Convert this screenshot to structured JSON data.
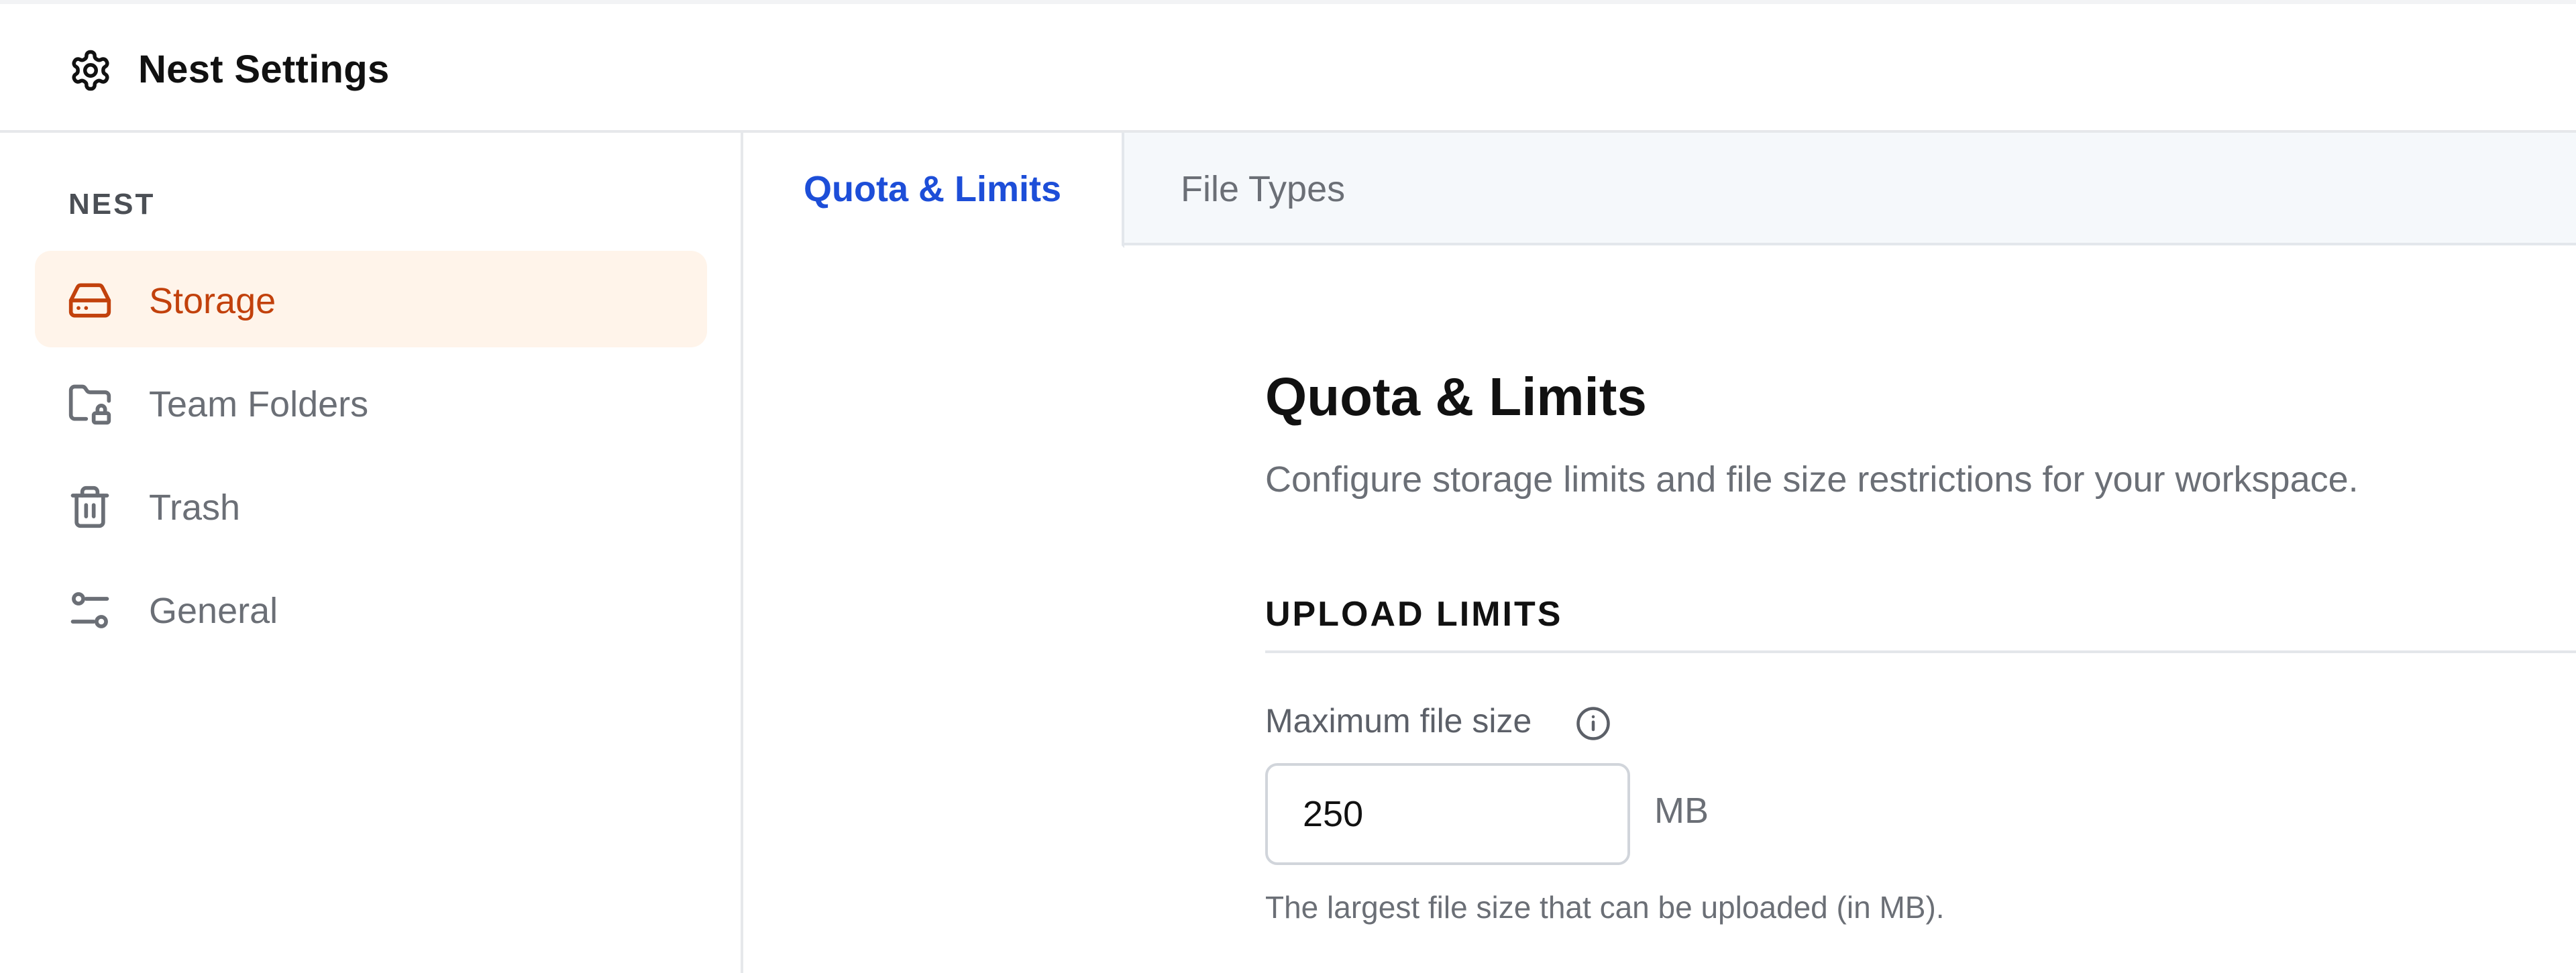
{
  "app": {
    "title": "Nest Settings",
    "icon": "gear-icon"
  },
  "sidebar": {
    "section_title": "NEST",
    "items": [
      {
        "label": "Storage",
        "icon": "hard-drive-icon",
        "active": true
      },
      {
        "label": "Team Folders",
        "icon": "folder-lock-icon",
        "active": false
      },
      {
        "label": "Trash",
        "icon": "trash-icon",
        "active": false
      },
      {
        "label": "General",
        "icon": "sliders-icon",
        "active": false
      }
    ]
  },
  "tabs": [
    {
      "label": "Quota & Limits",
      "active": true
    },
    {
      "label": "File Types",
      "active": false
    }
  ],
  "main": {
    "title": "Quota & Limits",
    "description": "Configure storage limits and file size restrictions for your workspace.",
    "section_heading": "UPLOAD LIMITS",
    "field": {
      "label": "Maximum file size",
      "value": "250",
      "unit": "MB",
      "help": "The largest file size that can be uploaded (in MB)."
    }
  },
  "colors": {
    "accent_active_nav": "#c2410c",
    "active_nav_bg": "#fff4ea",
    "active_tab": "#1d4ed8"
  }
}
